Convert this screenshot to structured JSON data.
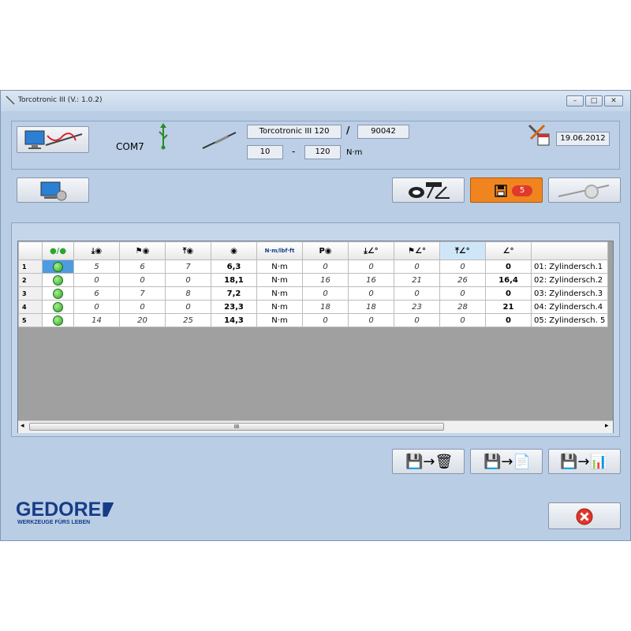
{
  "window": {
    "title": "Torcotronic III (V.: 1.0.2)",
    "minimize": "–",
    "maximize": "□",
    "close": "✕"
  },
  "device": {
    "port": "COM7",
    "model": "Torcotronic III 120",
    "separator": "/",
    "serial": "90042",
    "range_min": "10",
    "range_dash": "-",
    "range_max": "120",
    "unit": "N·m",
    "date": "19.06.2012"
  },
  "toolbar": {
    "saved_count": "5"
  },
  "table": {
    "headers": [
      "",
      "●/●",
      "⤓◉",
      "⚑◉",
      "⤒◉",
      "◉",
      "N·m/lbf·ft",
      "P◉",
      "⤓∠°",
      "⚑∠°",
      "⤒∠°",
      "∠°",
      ""
    ],
    "rows": [
      {
        "num": "1",
        "c": [
          "5",
          "6",
          "7",
          "6,3",
          "N·m",
          "0",
          "0",
          "0",
          "0",
          "0"
        ],
        "name": "01: Zylindersch.1"
      },
      {
        "num": "2",
        "c": [
          "0",
          "0",
          "0",
          "18,1",
          "N·m",
          "16",
          "16",
          "21",
          "26",
          "16,4"
        ],
        "name": "02: Zylindersch.2"
      },
      {
        "num": "3",
        "c": [
          "6",
          "7",
          "8",
          "7,2",
          "N·m",
          "0",
          "0",
          "0",
          "0",
          "0"
        ],
        "name": "03: Zylindersch.3"
      },
      {
        "num": "4",
        "c": [
          "0",
          "0",
          "0",
          "23,3",
          "N·m",
          "18",
          "18",
          "23",
          "28",
          "21"
        ],
        "name": "04: Zylindersch.4"
      },
      {
        "num": "5",
        "c": [
          "14",
          "20",
          "25",
          "14,3",
          "N·m",
          "0",
          "0",
          "0",
          "0",
          "0"
        ],
        "name": "05: Zylindersch. 5"
      }
    ]
  },
  "scroll": {
    "thumb_label": "III",
    "left_arrow": "◂",
    "right_arrow": "▸"
  },
  "brand": {
    "name": "GEDORE",
    "tagline": "WERKZEUGE FÜRS LEBEN"
  },
  "colors": {
    "window_bg": "#b9cde5",
    "accent_orange": "#f0851f",
    "badge_red": "#e03a2a",
    "brand_blue": "#173c86",
    "status_green": "#2ca62c"
  }
}
